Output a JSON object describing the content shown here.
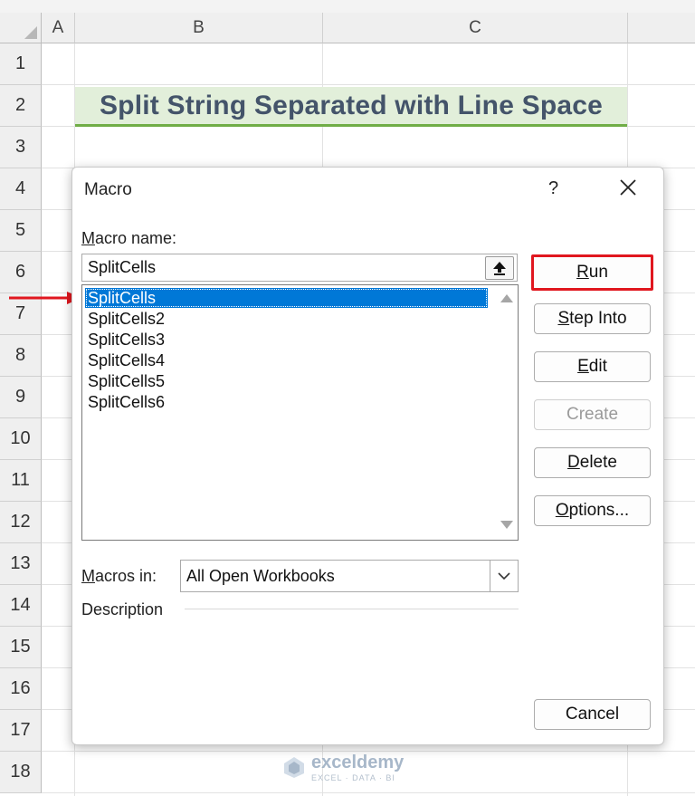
{
  "sheet": {
    "columns": [
      "A",
      "B",
      "C"
    ],
    "rows": [
      "1",
      "2",
      "3",
      "4",
      "5",
      "6",
      "7",
      "8",
      "9",
      "10",
      "11",
      "12",
      "13",
      "14",
      "15",
      "16",
      "17",
      "18"
    ],
    "title_cell": "Split String Separated with Line Space"
  },
  "dialog": {
    "title": "Macro",
    "help": "?",
    "macro_name_label": "Macro name:",
    "macro_name_value": "SplitCells",
    "macro_list": [
      "SplitCells",
      "SplitCells2",
      "SplitCells3",
      "SplitCells4",
      "SplitCells5",
      "SplitCells6"
    ],
    "selected_macro": "SplitCells",
    "macros_in_label": "Macros in:",
    "macros_in_value": "All Open Workbooks",
    "description_label": "Description",
    "buttons": {
      "run": "Run",
      "step_into": "Step Into",
      "edit": "Edit",
      "create": "Create",
      "delete": "Delete",
      "options": "Options...",
      "cancel": "Cancel"
    }
  },
  "annotations": {
    "highlight_color": "#e0171f",
    "selection_color": "#0078d7"
  },
  "watermark": {
    "brand": "exceldemy",
    "tagline": "EXCEL · DATA · BI"
  }
}
